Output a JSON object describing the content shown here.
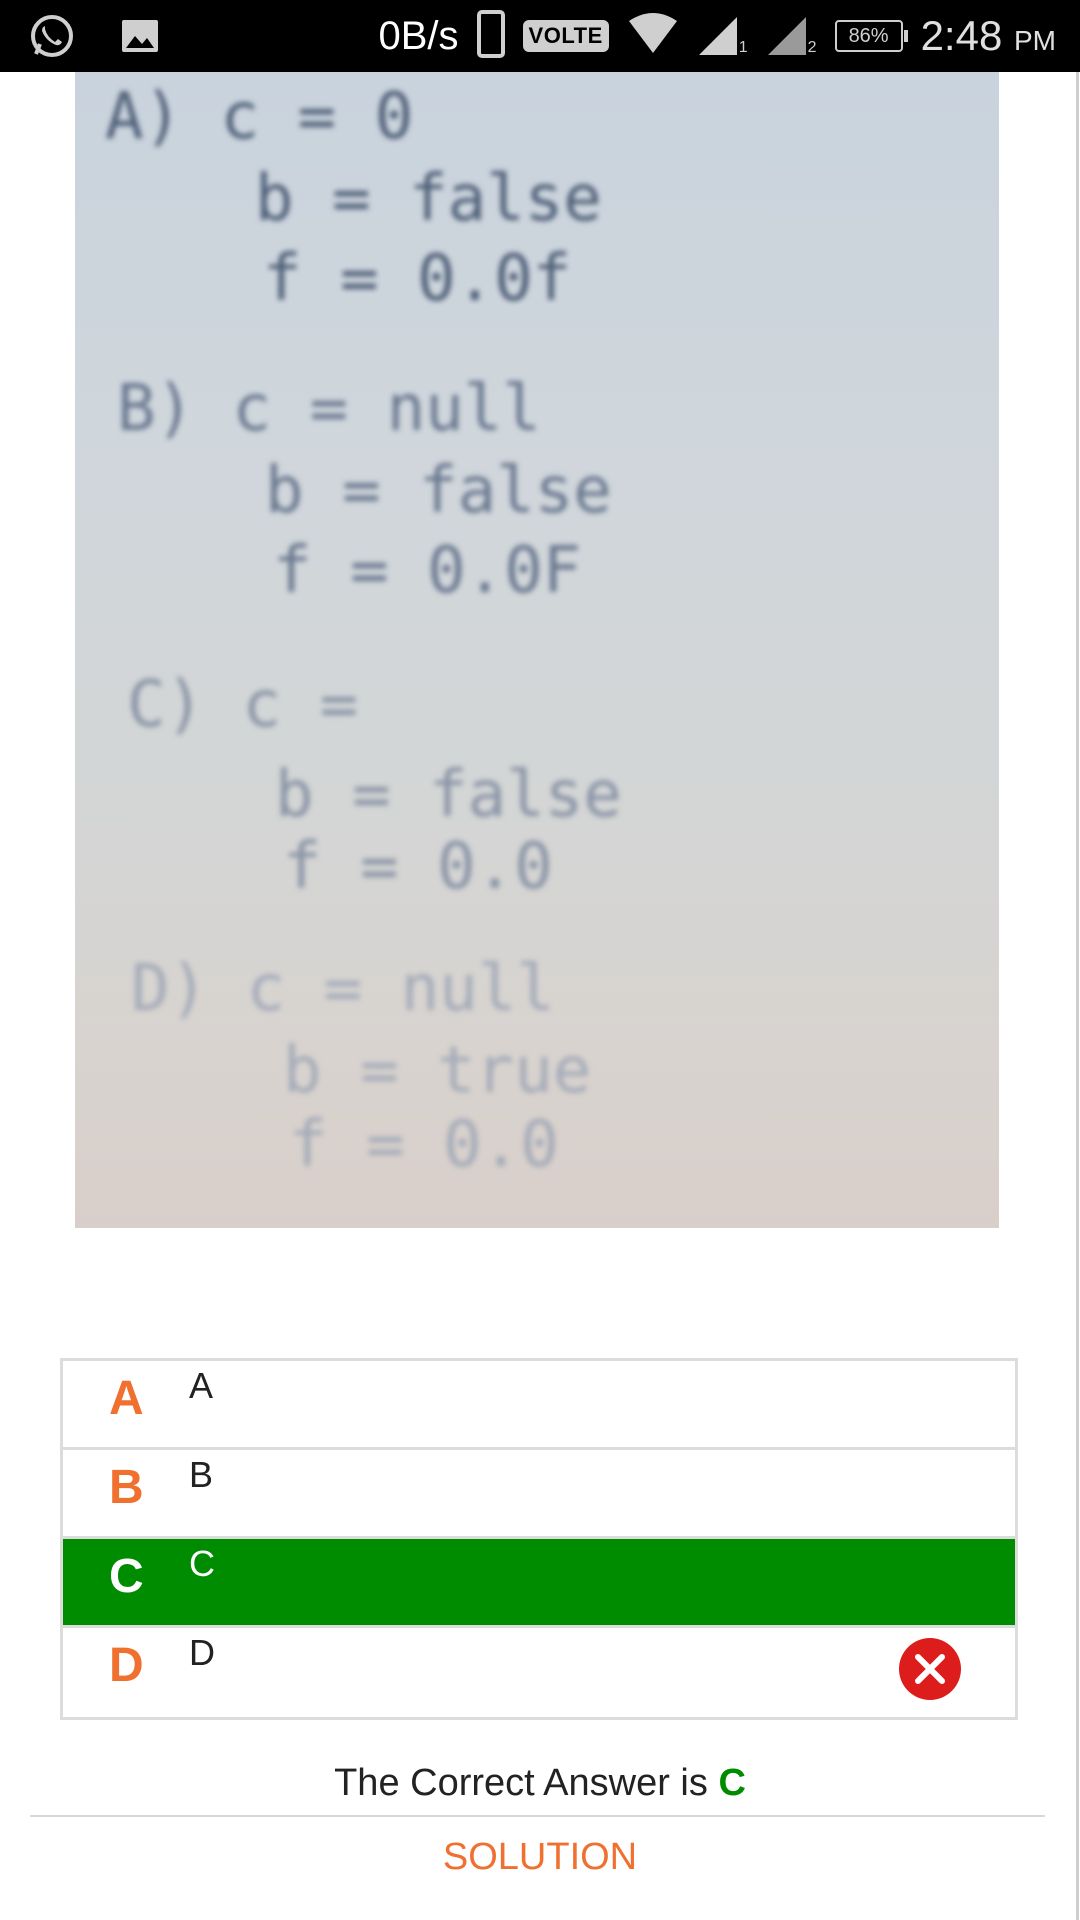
{
  "status_bar": {
    "network_speed": "0B/s",
    "volte": "VOLTE",
    "sim1": "1",
    "sim2": "2",
    "battery": "86%",
    "time": "2:48",
    "ampm": "PM",
    "icons": [
      "whatsapp-icon",
      "gallery-icon",
      "phone-icon",
      "wifi-icon",
      "signal-icon",
      "battery-icon"
    ]
  },
  "question_image": {
    "lines": [
      "A) c = 0",
      "b = false",
      "f = 0.0f",
      "B) c = null",
      "b = false",
      "f = 0.0F",
      "C) c =",
      "b = false",
      "f = 0.0",
      "D) c = null",
      "b = true",
      "f = 0.0"
    ]
  },
  "options": [
    {
      "letter": "A",
      "text": "A"
    },
    {
      "letter": "B",
      "text": "B"
    },
    {
      "letter": "C",
      "text": "C"
    },
    {
      "letter": "D",
      "text": "D"
    }
  ],
  "colors": {
    "correct": "#008c00",
    "accent": "#f07030",
    "wrong": "#dd1c1c"
  },
  "answer": {
    "prefix": "The Correct Answer is",
    "letter": "C"
  },
  "solution_label": "SOLUTION"
}
